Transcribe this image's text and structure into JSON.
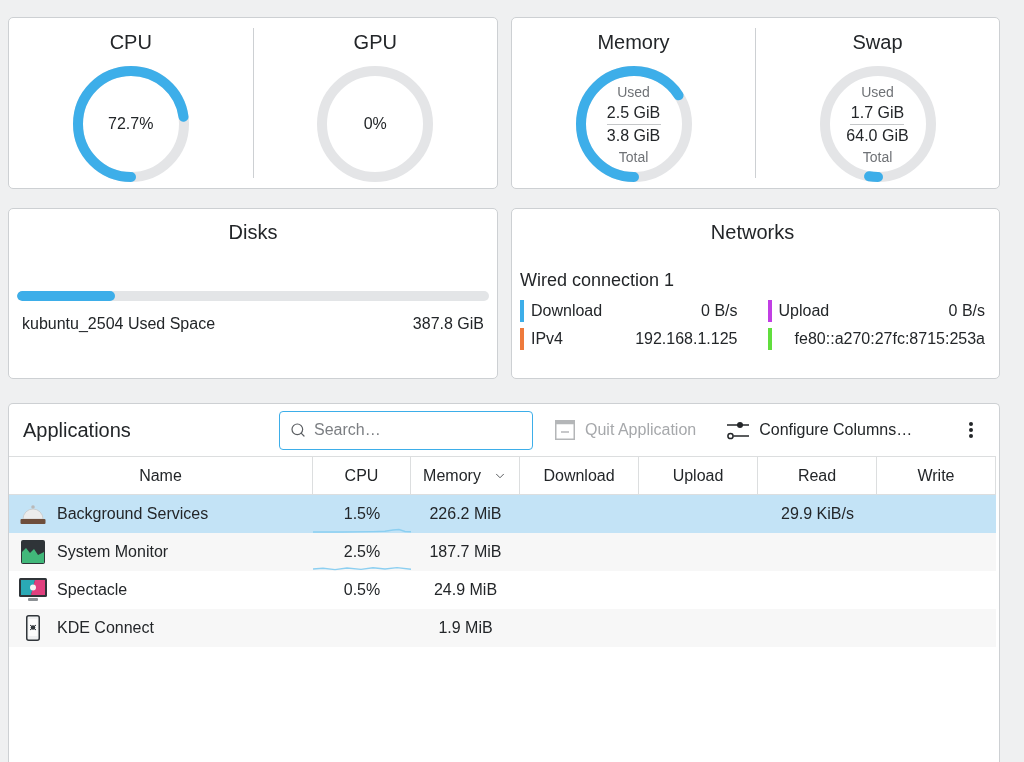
{
  "overview": [
    {
      "gauges": [
        {
          "kind": "percent",
          "title": "CPU",
          "level": 0.727,
          "reading": "72.7%"
        },
        {
          "kind": "percent",
          "title": "GPU",
          "level": 0,
          "reading": "0%"
        }
      ]
    },
    {
      "gauges": [
        {
          "kind": "used_total",
          "title": "Memory",
          "level": 0.658,
          "used_label": "Used",
          "used": "2.5 GiB",
          "total": "3.8 GiB",
          "total_label": "Total"
        },
        {
          "kind": "used_total",
          "title": "Swap",
          "level": 0.027,
          "used_label": "Used",
          "used": "1.7 GiB",
          "total": "64.0 GiB",
          "total_label": "Total"
        }
      ]
    }
  ],
  "disks": {
    "title": "Disks",
    "items": [
      {
        "name": "kubuntu_2504 Used Space",
        "level": 0.208,
        "value": "387.8 GiB"
      }
    ]
  },
  "networks": {
    "title": "Networks",
    "connection": "Wired connection 1",
    "items": [
      {
        "label": "Download",
        "value": "0 B/s",
        "color": "#3daee9"
      },
      {
        "label": "Upload",
        "value": "0 B/s",
        "color": "#c13fe4"
      },
      {
        "label": "IPv4",
        "value": "192.168.1.125",
        "color": "#ee7a3c"
      },
      {
        "value": "fe80::a270:27fc:8715:253a",
        "color": "#61de3e"
      }
    ]
  },
  "applications": {
    "title": "Applications",
    "search": {
      "placeholder": "Search…"
    },
    "actions": [
      {
        "label": "Quit Application",
        "disabled": true
      },
      {
        "label": "Configure Columns…",
        "disabled": false
      }
    ],
    "table": {
      "columns": [
        {
          "label": "Name",
          "sorted": false
        },
        {
          "label": "CPU",
          "sorted": false
        },
        {
          "label": "Memory",
          "sorted": true
        },
        {
          "label": "Download",
          "sorted": false
        },
        {
          "label": "Upload",
          "sorted": false
        },
        {
          "label": "Read",
          "sorted": false
        },
        {
          "label": "Write",
          "sorted": false
        }
      ],
      "rows": [
        {
          "name": "Background Services",
          "cpu": "1.5%",
          "memory": "226.2 MiB",
          "read": "29.9 KiB/s",
          "selected": true,
          "cpu_graph": true
        },
        {
          "name": "System Monitor",
          "cpu": "2.5%",
          "memory": "187.7 MiB",
          "selected": false,
          "cpu_graph": true
        },
        {
          "name": "Spectacle",
          "cpu": "0.5%",
          "memory": "24.9 MiB",
          "selected": false,
          "cpu_graph": false
        },
        {
          "name": "KDE Connect",
          "memory": "1.9 MiB",
          "selected": false,
          "cpu_graph": false
        }
      ]
    }
  }
}
